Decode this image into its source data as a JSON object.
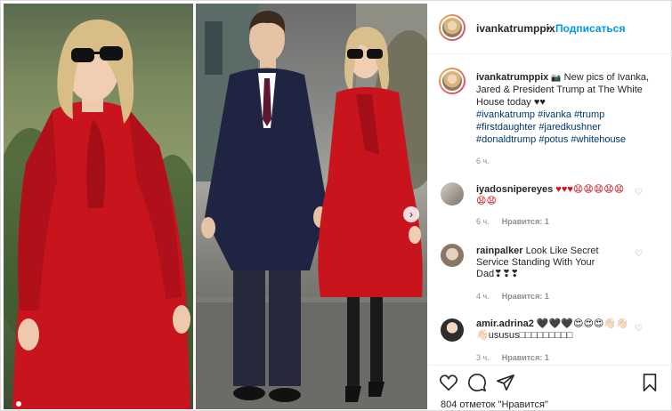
{
  "post": {
    "username": "ivankatrumppix",
    "separator": "•",
    "follow_label": "Подписаться"
  },
  "caption": {
    "username": "ivankatrumppix",
    "emoji_box": "📷",
    "text": "New pics of Ivanka, Jared & President Trump at The White House today ♥♥",
    "tags": "#ivankatrump #ivanka #trump #firstdaughter #jaredkushner #donaldtrump #potus #whitehouse",
    "time": "6 ч."
  },
  "comments": [
    {
      "username": "iyadosnipereyes",
      "text": "♥♥♥😧😧😧😧😧😧😧",
      "time": "6 ч.",
      "likes": "Нравится: 1"
    },
    {
      "username": "rainpalker",
      "text": "Look Like Secret Service Standing With Your Dad❣❣❣",
      "time": "4 ч.",
      "likes": "Нравится: 1"
    },
    {
      "username": "amir.adrina2",
      "text": "🖤🖤🖤😍😍😍👋🏻👋🏻 👋🏻ususus□□□□□□□□□",
      "time": "3 ч.",
      "likes": "Нравится: 1"
    }
  ],
  "footer": {
    "likes_text": "804 отметок \"Нравится\""
  },
  "icons": {
    "heart": "heart-icon",
    "comment": "comment-icon",
    "share": "share-icon",
    "save": "bookmark-icon",
    "next": "chevron-right-icon"
  },
  "colors": {
    "link": "#0095f6",
    "hashtag": "#00376b",
    "like": "#ed4956",
    "muted": "#8e8e8e"
  }
}
